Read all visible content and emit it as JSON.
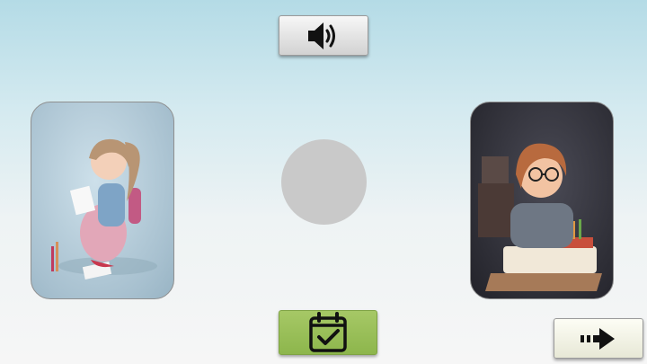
{
  "controls": {
    "sound_icon": "speaker-volume-icon",
    "check_icon": "calendar-check-icon",
    "next_icon": "arrow-right-icon"
  },
  "cards": [
    {
      "id": "girl-drawing-card",
      "subject": "girl-drawing-image"
    },
    {
      "id": "girl-studying-card",
      "subject": "girl-studying-image"
    }
  ],
  "colors": {
    "check_button": "#97be55",
    "drop_target": "#c9c9c9",
    "background_top": "#b4dbe6",
    "background_bottom": "#f6f6f6"
  }
}
